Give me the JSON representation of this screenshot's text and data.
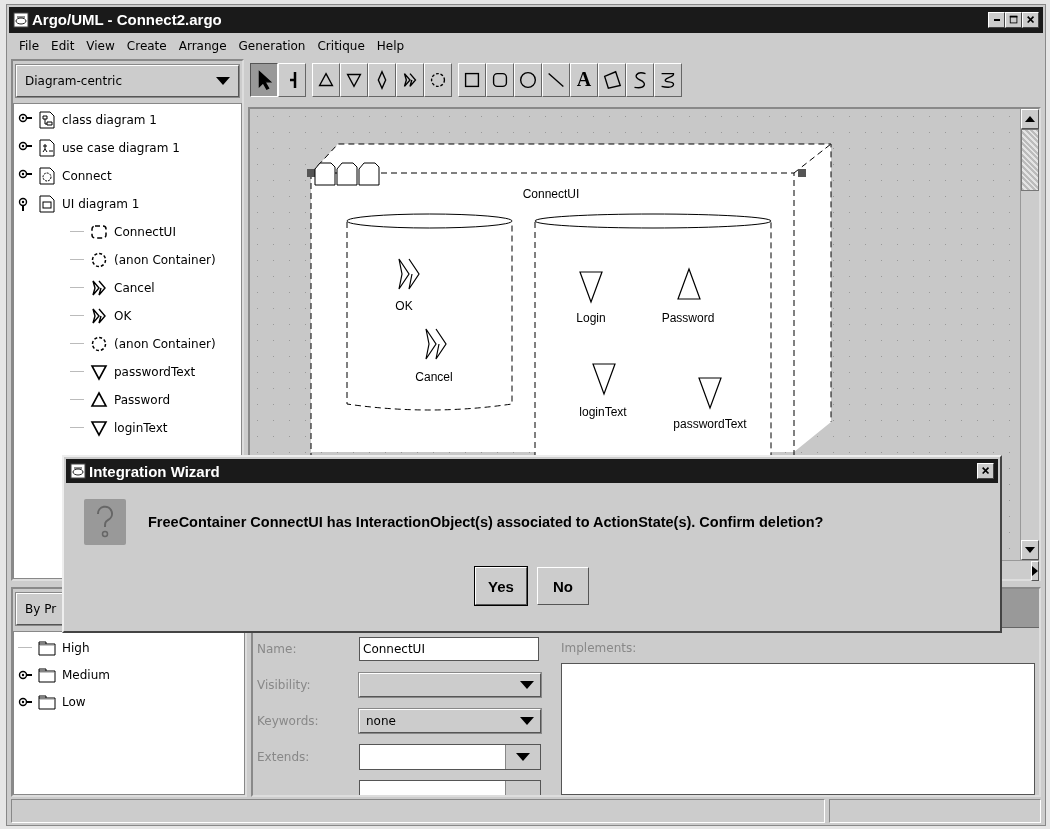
{
  "window": {
    "title": "Argo/UML - Connect2.argo"
  },
  "menu": [
    {
      "label": "File"
    },
    {
      "label": "Edit"
    },
    {
      "label": "View"
    },
    {
      "label": "Create"
    },
    {
      "label": "Arrange"
    },
    {
      "label": "Generation"
    },
    {
      "label": "Critique"
    },
    {
      "label": "Help"
    }
  ],
  "navigator": {
    "perspective": "Diagram-centric",
    "tree": [
      {
        "label": "class diagram 1",
        "kind": "class",
        "expanded": false
      },
      {
        "label": "use case diagram 1",
        "kind": "usecase",
        "expanded": false
      },
      {
        "label": "Connect",
        "kind": "state",
        "expanded": false
      },
      {
        "label": "UI diagram 1",
        "kind": "ui",
        "expanded": true,
        "children": [
          {
            "label": "ConnectUI",
            "kind": "free"
          },
          {
            "label": "(anon Container)",
            "kind": "container"
          },
          {
            "label": "Cancel",
            "kind": "action"
          },
          {
            "label": "OK",
            "kind": "action"
          },
          {
            "label": "(anon Container)",
            "kind": "container"
          },
          {
            "label": "passwordText",
            "kind": "input"
          },
          {
            "label": "Password",
            "kind": "output"
          },
          {
            "label": "loginText",
            "kind": "input"
          }
        ]
      }
    ]
  },
  "toolbar": [
    [
      {
        "kind": "select",
        "selected": true
      },
      {
        "kind": "broom",
        "selected": false
      }
    ],
    [
      {
        "kind": "output",
        "selected": false
      },
      {
        "kind": "input",
        "selected": false
      },
      {
        "kind": "io",
        "selected": false
      },
      {
        "kind": "action",
        "selected": false
      },
      {
        "kind": "container",
        "selected": false
      }
    ],
    [
      {
        "kind": "rect",
        "selected": false
      },
      {
        "kind": "rrect",
        "selected": false
      },
      {
        "kind": "circle",
        "selected": false
      },
      {
        "kind": "line",
        "selected": false
      },
      {
        "kind": "text",
        "label": "A",
        "selected": false
      },
      {
        "kind": "poly",
        "selected": false
      },
      {
        "kind": "spline",
        "selected": false
      },
      {
        "kind": "ink",
        "selected": false
      }
    ]
  ],
  "diagram": {
    "name": "ConnectUI",
    "containers": [
      {
        "items": [
          {
            "kind": "action",
            "label": "OK"
          },
          {
            "kind": "action",
            "label": "Cancel"
          }
        ]
      },
      {
        "items": [
          {
            "kind": "input",
            "label": "Login"
          },
          {
            "kind": "output",
            "label": "Password"
          },
          {
            "kind": "input",
            "label": "loginText"
          },
          {
            "kind": "input",
            "label": "passwordText"
          }
        ]
      }
    ]
  },
  "todo": {
    "perspective": "By Pr",
    "tree": [
      {
        "label": "High",
        "has_children": false
      },
      {
        "label": "Medium",
        "has_children": true
      },
      {
        "label": "Low",
        "has_children": true
      }
    ]
  },
  "properties": {
    "fields": [
      {
        "label": "Name:",
        "kind": "text",
        "value": "ConnectUI"
      },
      {
        "label": "Visibility:",
        "kind": "combo"
      },
      {
        "label": "Keywords:",
        "kind": "combo",
        "value": "none"
      },
      {
        "label": "Extends:",
        "kind": "editcombo"
      }
    ],
    "implements": {
      "label": "Implements:"
    }
  },
  "dialog": {
    "title": "Integration Wizard",
    "message": "FreeContainer ConnectUI has InteractionObject(s) associated to ActionState(s). Confirm deletion?",
    "buttons": [
      {
        "label": "Yes",
        "focused": true
      },
      {
        "label": "No",
        "focused": false
      }
    ]
  }
}
